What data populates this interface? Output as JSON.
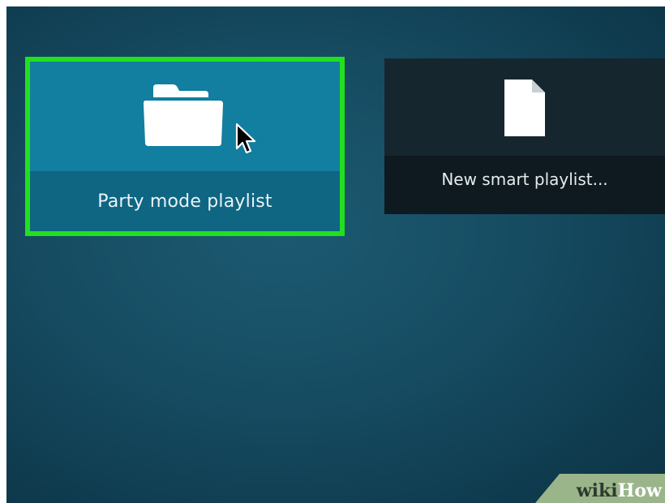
{
  "tiles": {
    "party_mode": {
      "label": "Party mode playlist",
      "icon": "folder-icon",
      "selected": true,
      "highlight_color": "#22e01e"
    },
    "new_smart": {
      "label": "New smart playlist...",
      "icon": "file-icon"
    }
  },
  "cursor": {
    "icon": "mouse-pointer-icon"
  },
  "watermark": {
    "part1": "wiki",
    "part2": "How"
  },
  "colors": {
    "accent_blue": "#127ea0",
    "label_blue": "#0e6683",
    "dark_tile": "#16262e",
    "highlight_green": "#22e01e"
  }
}
